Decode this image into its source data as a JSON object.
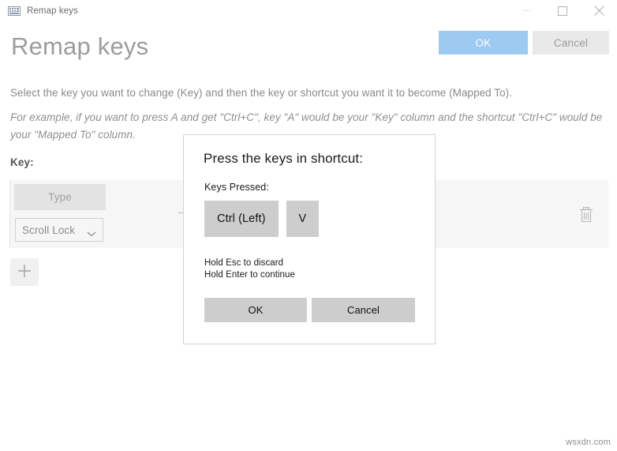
{
  "window": {
    "titlebar_title": "Remap keys",
    "app_icon": "keyboard-icon",
    "controls": {
      "minimize": "minimize-icon",
      "maximize": "maximize-icon",
      "close": "close-icon"
    }
  },
  "header": {
    "page_title": "Remap keys",
    "ok_label": "OK",
    "cancel_label": "Cancel",
    "ok_color": "#9ccaf0",
    "cancel_color": "#e9e9e9"
  },
  "description": {
    "line1": "Select the key you want to change (Key) and then the key or shortcut you want it to become (Mapped To).",
    "line2": "For example, if you want to press A and get \"Ctrl+C\", key \"A\" would be your \"Key\" column and the shortcut \"Ctrl+C\" would be your \"Mapped To\" column."
  },
  "columns": {
    "key_label": "Key:"
  },
  "mapping_row": {
    "type_button_label": "Type",
    "key_select_value": "Scroll Lock",
    "key_select_options": [
      "Scroll Lock"
    ],
    "chevron_icon": "chevron-down-icon",
    "delete_icon": "trash-icon",
    "row_background": "#f6f6f6"
  },
  "add_button": {
    "icon": "plus-icon"
  },
  "dialog": {
    "title": "Press the keys in shortcut:",
    "subtitle": "Keys Pressed:",
    "keys": [
      "Ctrl (Left)",
      "V"
    ],
    "hint_line1": "Hold Esc to discard",
    "hint_line2": "Hold Enter to continue",
    "ok_label": "OK",
    "cancel_label": "Cancel",
    "chip_color": "#cdcdcd"
  },
  "watermark": "wsxdn.com"
}
